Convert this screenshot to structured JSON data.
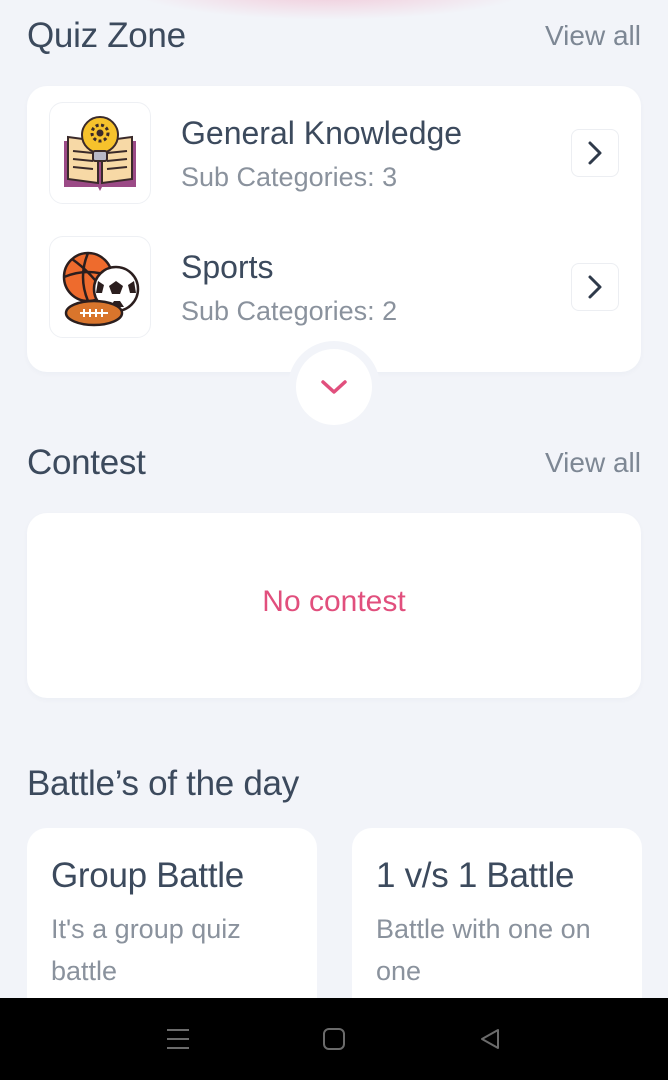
{
  "quiz_zone": {
    "title": "Quiz Zone",
    "view_all": "View all",
    "categories": [
      {
        "title": "General Knowledge",
        "sub": "Sub Categories: 3",
        "icon": "book-lightbulb-icon"
      },
      {
        "title": "Sports",
        "sub": "Sub Categories: 2",
        "icon": "sports-balls-icon"
      }
    ]
  },
  "contest": {
    "title": "Contest",
    "view_all": "View all",
    "empty_text": "No contest"
  },
  "battles": {
    "title": "Battle’s of the day",
    "items": [
      {
        "title": "Group Battle",
        "desc": "It's a group quiz battle"
      },
      {
        "title": "1 v/s 1 Battle",
        "desc": "Battle with one on one"
      }
    ]
  },
  "colors": {
    "accent": "#e14f7d",
    "heading": "#3c4a5d",
    "muted": "#8a929d",
    "background": "#f2f4f9"
  }
}
